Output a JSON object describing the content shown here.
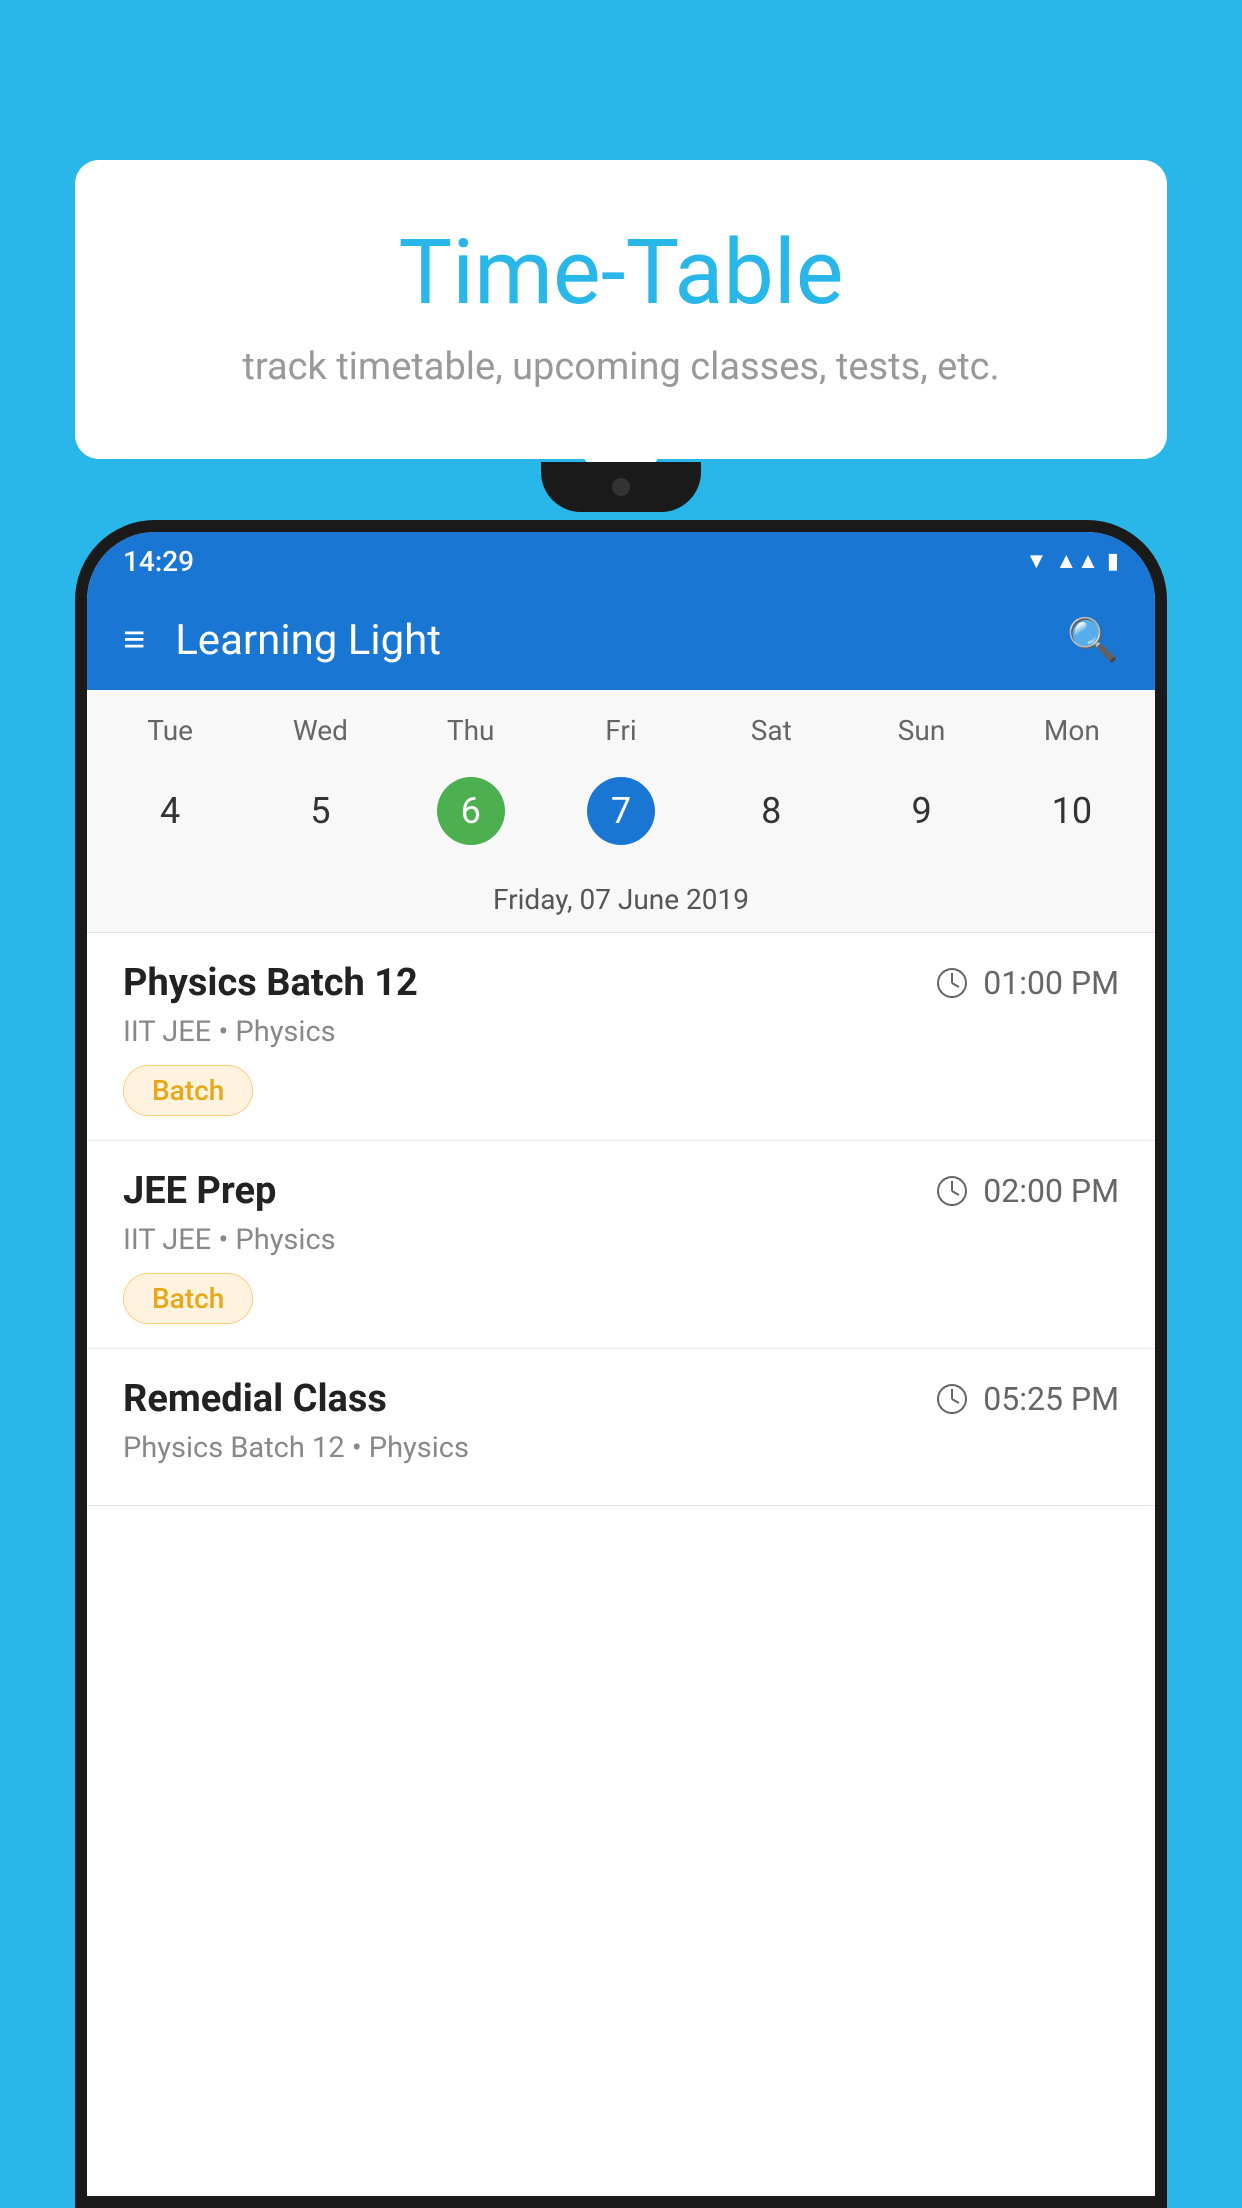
{
  "background": {
    "color": "#29B6E8"
  },
  "header": {
    "title": "Time-Table",
    "subtitle": "track timetable, upcoming classes, tests, etc."
  },
  "phone": {
    "statusBar": {
      "time": "14:29"
    },
    "appBar": {
      "title": "Learning Light"
    },
    "calendar": {
      "days": [
        "Tue",
        "Wed",
        "Thu",
        "Fri",
        "Sat",
        "Sun",
        "Mon"
      ],
      "dates": [
        {
          "num": "4",
          "state": "normal"
        },
        {
          "num": "5",
          "state": "normal"
        },
        {
          "num": "6",
          "state": "today"
        },
        {
          "num": "7",
          "state": "selected"
        },
        {
          "num": "8",
          "state": "normal"
        },
        {
          "num": "9",
          "state": "normal"
        },
        {
          "num": "10",
          "state": "normal"
        }
      ],
      "selectedDateLabel": "Friday, 07 June 2019"
    },
    "schedule": [
      {
        "title": "Physics Batch 12",
        "time": "01:00 PM",
        "subtitle": "IIT JEE • Physics",
        "tag": "Batch"
      },
      {
        "title": "JEE Prep",
        "time": "02:00 PM",
        "subtitle": "IIT JEE • Physics",
        "tag": "Batch"
      },
      {
        "title": "Remedial Class",
        "time": "05:25 PM",
        "subtitle": "Physics Batch 12 • Physics",
        "tag": ""
      }
    ]
  }
}
